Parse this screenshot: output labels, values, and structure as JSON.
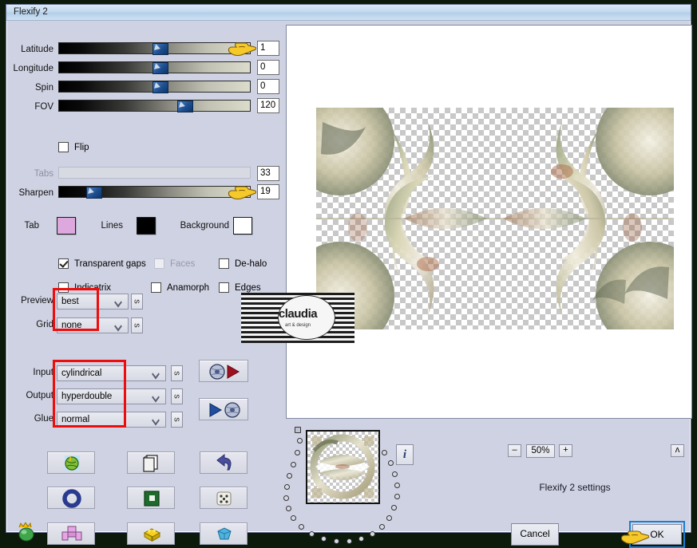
{
  "window": {
    "title": "Flexify 2"
  },
  "sliders": [
    {
      "label": "Latitude",
      "value": "1",
      "pos": 50,
      "disabled": false,
      "hand": true
    },
    {
      "label": "Longitude",
      "value": "0",
      "pos": 50,
      "disabled": false,
      "hand": false
    },
    {
      "label": "Spin",
      "value": "0",
      "pos": 50,
      "disabled": false,
      "hand": false
    },
    {
      "label": "FOV",
      "value": "120",
      "pos": 62.5,
      "disabled": false,
      "hand": false
    },
    {
      "label": "Tabs",
      "value": "33",
      "pos": 0,
      "disabled": true,
      "hand": false
    },
    {
      "label": "Sharpen",
      "value": "19",
      "pos": 14,
      "disabled": false,
      "hand": true
    }
  ],
  "flip": {
    "label": "Flip",
    "checked": false
  },
  "colors": {
    "tab": {
      "label": "Tab",
      "value": "#dda8dd"
    },
    "lines": {
      "label": "Lines",
      "value": "#000000"
    },
    "background": {
      "label": "Background",
      "value": "#ffffff"
    }
  },
  "checkboxes": [
    {
      "label": "Transparent gaps",
      "checked": true,
      "disabled": false
    },
    {
      "label": "Faces",
      "checked": false,
      "disabled": true
    },
    {
      "label": "De-halo",
      "checked": false,
      "disabled": false
    },
    {
      "label": "Indicatrix",
      "checked": false,
      "disabled": false
    },
    {
      "label": "Anamorph",
      "checked": false,
      "disabled": false
    },
    {
      "label": "Edges",
      "checked": false,
      "disabled": false
    }
  ],
  "dropdowns": [
    {
      "label": "Preview",
      "value": "best",
      "side_button": "s"
    },
    {
      "label": "Grid",
      "value": "none",
      "side_button": "s"
    },
    {
      "label": "Input",
      "value": "cylindrical",
      "side_button": "s"
    },
    {
      "label": "Output",
      "value": "hyperdouble",
      "side_button": "s"
    },
    {
      "label": "Glue",
      "value": "normal",
      "side_button": "s"
    }
  ],
  "icon_buttons": [
    {
      "name": "globe-arrow-button"
    },
    {
      "name": "arrow-globe-button"
    }
  ],
  "tool_grid": [
    {
      "name": "earth-icon"
    },
    {
      "name": "copy-pages-icon"
    },
    {
      "name": "undo-arrow-icon"
    },
    {
      "name": "blue-ring-icon"
    },
    {
      "name": "green-square-icon"
    },
    {
      "name": "dice-icon"
    },
    {
      "name": "pink-cross-icon"
    },
    {
      "name": "yellow-brick-icon"
    },
    {
      "name": "blue-gem-icon"
    }
  ],
  "flame_icon": {
    "name": "green-flame-icon"
  },
  "zoom": {
    "minus": "–",
    "value": "50%",
    "plus": "+"
  },
  "collapse_button": {
    "label": "ʌ"
  },
  "info_button": {
    "label": "i"
  },
  "status": {
    "text": "Flexify 2 settings"
  },
  "buttons": {
    "cancel": {
      "label": "Cancel"
    },
    "ok": {
      "label": "OK",
      "focused": true
    }
  },
  "watermark": {
    "text": "claudia",
    "subtext": "art & design"
  },
  "accent": {
    "focus_blue": "#1a7fd4",
    "highlight_red": "#ee0d0d"
  }
}
